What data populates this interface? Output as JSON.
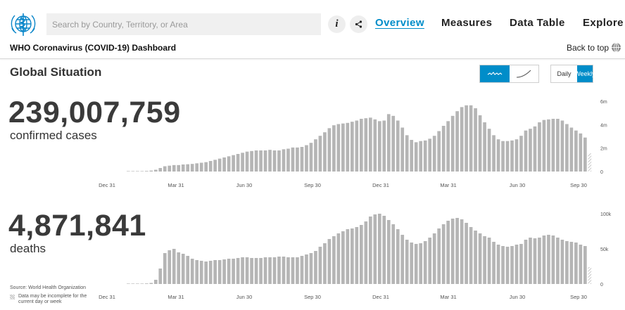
{
  "header": {
    "search_placeholder": "Search by Country, Territory, or Area",
    "info_label": "i",
    "nav": [
      "Overview",
      "Measures",
      "Data Table",
      "Explore"
    ],
    "dashboard_title": "WHO Coronavirus (COVID-19) Dashboard",
    "back_to_top": "Back to top"
  },
  "main": {
    "section_title": "Global Situation",
    "toggle_daily": "Daily",
    "toggle_weekly": "Weekly",
    "cases_total": "239,007,759",
    "cases_label": "confirmed cases",
    "deaths_total": "4,871,841",
    "deaths_label": "deaths",
    "source": "Source: World Health Organization",
    "note": "Data may be incomplete for the current day or week"
  },
  "colors": {
    "accent": "#008dc9",
    "bar": "#b5b5b5",
    "text": "#333333"
  },
  "chart_data": [
    {
      "type": "bar",
      "x_tick_labels": [
        "Dec 31",
        "Mar 31",
        "Jun 30",
        "Sep 30",
        "Dec 31",
        "Mar 31",
        "Jun 30",
        "Sep 30"
      ],
      "y_tick_labels": [
        "6m",
        "4m",
        "2m",
        "0"
      ],
      "ylim": [
        0,
        6000000
      ],
      "unit": 1000000,
      "values": [
        0.01,
        0.01,
        0.02,
        0.03,
        0.05,
        0.08,
        0.15,
        0.3,
        0.45,
        0.5,
        0.55,
        0.55,
        0.6,
        0.62,
        0.65,
        0.7,
        0.75,
        0.8,
        0.9,
        1.0,
        1.1,
        1.2,
        1.3,
        1.4,
        1.5,
        1.6,
        1.7,
        1.75,
        1.8,
        1.8,
        1.8,
        1.85,
        1.8,
        1.8,
        1.9,
        1.95,
        2.05,
        2.05,
        2.1,
        2.25,
        2.45,
        2.75,
        3.05,
        3.35,
        3.7,
        3.95,
        4.05,
        4.1,
        4.15,
        4.25,
        4.35,
        4.5,
        4.55,
        4.6,
        4.45,
        4.3,
        4.35,
        4.9,
        4.75,
        4.35,
        3.75,
        3.1,
        2.7,
        2.5,
        2.6,
        2.65,
        2.8,
        3.05,
        3.45,
        3.9,
        4.3,
        4.75,
        5.15,
        5.5,
        5.65,
        5.65,
        5.4,
        4.8,
        4.2,
        3.65,
        3.1,
        2.75,
        2.6,
        2.6,
        2.65,
        2.75,
        3.05,
        3.5,
        3.65,
        3.85,
        4.2,
        4.4,
        4.45,
        4.5,
        4.5,
        4.35,
        4.05,
        3.75,
        3.5,
        3.25,
        2.9,
        1.55
      ],
      "partial_last": true
    },
    {
      "type": "bar",
      "x_tick_labels": [
        "Dec 31",
        "Mar 31",
        "Jun 30",
        "Sep 30",
        "Dec 31",
        "Mar 31",
        "Jun 30",
        "Sep 30"
      ],
      "y_tick_labels": [
        "100k",
        "50k",
        "0"
      ],
      "ylim": [
        0,
        100000
      ],
      "unit": 1000,
      "values": [
        0.3,
        0.4,
        0.5,
        0.6,
        0.8,
        1.5,
        6,
        22,
        44,
        48,
        50,
        45,
        43,
        40,
        36,
        34,
        33,
        32,
        33,
        34,
        34,
        35,
        36,
        36,
        37,
        38,
        38,
        37,
        37,
        37,
        38,
        38,
        38,
        39,
        39,
        38,
        38,
        38,
        40,
        42,
        44,
        47,
        53,
        58,
        64,
        68,
        72,
        75,
        78,
        79,
        81,
        84,
        89,
        96,
        99,
        100,
        97,
        91,
        85,
        78,
        70,
        63,
        59,
        57,
        58,
        61,
        66,
        72,
        79,
        85,
        90,
        93,
        94,
        92,
        87,
        81,
        76,
        72,
        68,
        66,
        60,
        56,
        54,
        53,
        54,
        56,
        57,
        63,
        66,
        65,
        66,
        69,
        70,
        69,
        66,
        63,
        61,
        60,
        59,
        56,
        54,
        24
      ],
      "partial_last": true
    }
  ]
}
